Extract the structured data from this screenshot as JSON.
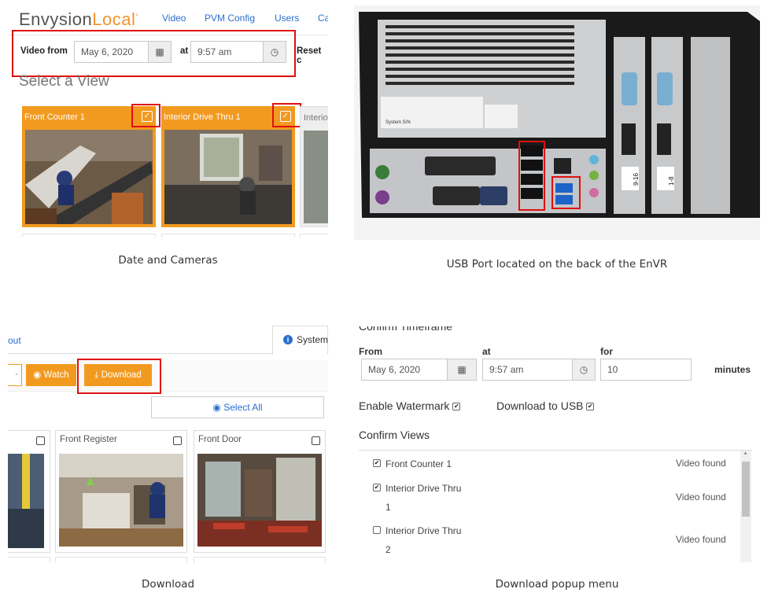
{
  "captions": {
    "p1": "Date and Cameras",
    "p2": "USB Port located on the back of the EnVR",
    "p3": "Download",
    "p4": "Download popup menu"
  },
  "panel1": {
    "brand_main": "Envysion",
    "brand_accent": "Local",
    "nav": [
      "Video",
      "PVM Config",
      "Users",
      "Ca"
    ],
    "video_from_label": "Video from",
    "date_value": "May 6, 2020",
    "at_label": "at",
    "time_value": "9:57 am",
    "reset_label": "Reset c",
    "select_view_heading": "Select a View",
    "cameras": [
      {
        "title": "Front Counter 1"
      },
      {
        "title": "Interior Drive Thru 1"
      },
      {
        "title": "Interio"
      }
    ]
  },
  "panel2": {
    "sticker_label": "System S/N",
    "slot_labels": [
      "9-16",
      "1-8"
    ]
  },
  "panel3": {
    "tab_left": "out",
    "tab_system": "System",
    "dot_label": "·",
    "watch_label": "Watch",
    "download_label": "Download",
    "select_all_label": "Select All",
    "tiles": [
      {
        "title": ""
      },
      {
        "title": "Front Register"
      },
      {
        "title": "Front Door"
      }
    ]
  },
  "panel4": {
    "cut_heading": "Confirm Timeframe",
    "from_label": "From",
    "at_label": "at",
    "for_label": "for",
    "date_value": "May 6, 2020",
    "time_value": "9:57 am",
    "duration_value": "10",
    "minutes_label": "minutes",
    "watermark_label": "Enable Watermark",
    "download_usb_label": "Download to USB",
    "confirm_views_heading": "Confirm Views",
    "views": [
      {
        "name": "Front Counter 1",
        "name2": "",
        "status": "Video found",
        "checked": true
      },
      {
        "name": "Interior Drive Thru",
        "name2": "1",
        "status": "Video found",
        "checked": true
      },
      {
        "name": "Interior Drive Thru",
        "name2": "2",
        "status": "Video found",
        "checked": false
      }
    ]
  },
  "colors": {
    "accent_orange": "#f29a1f",
    "link_blue": "#2a6fcf",
    "highlight_red": "#e01010"
  }
}
